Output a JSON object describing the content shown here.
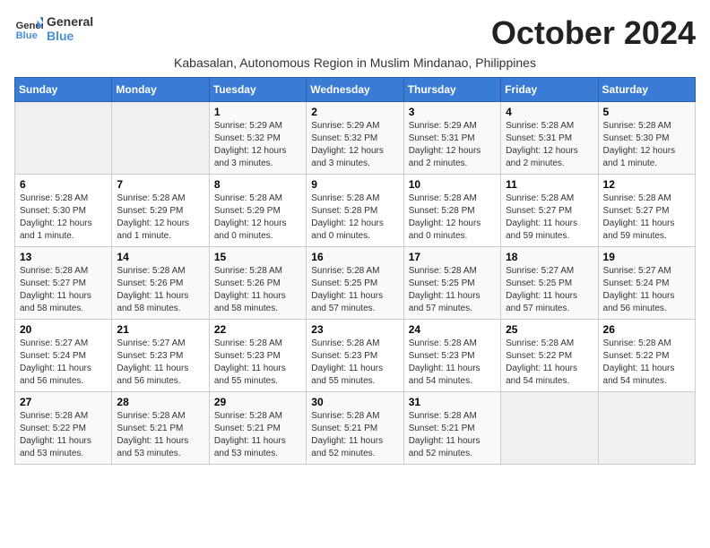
{
  "logo": {
    "line1": "General",
    "line2": "Blue"
  },
  "title": "October 2024",
  "subtitle": "Kabasalan, Autonomous Region in Muslim Mindanao, Philippines",
  "days_of_week": [
    "Sunday",
    "Monday",
    "Tuesday",
    "Wednesday",
    "Thursday",
    "Friday",
    "Saturday"
  ],
  "weeks": [
    [
      {
        "day": "",
        "info": ""
      },
      {
        "day": "",
        "info": ""
      },
      {
        "day": "1",
        "info": "Sunrise: 5:29 AM\nSunset: 5:32 PM\nDaylight: 12 hours and 3 minutes."
      },
      {
        "day": "2",
        "info": "Sunrise: 5:29 AM\nSunset: 5:32 PM\nDaylight: 12 hours and 3 minutes."
      },
      {
        "day": "3",
        "info": "Sunrise: 5:29 AM\nSunset: 5:31 PM\nDaylight: 12 hours and 2 minutes."
      },
      {
        "day": "4",
        "info": "Sunrise: 5:28 AM\nSunset: 5:31 PM\nDaylight: 12 hours and 2 minutes."
      },
      {
        "day": "5",
        "info": "Sunrise: 5:28 AM\nSunset: 5:30 PM\nDaylight: 12 hours and 1 minute."
      }
    ],
    [
      {
        "day": "6",
        "info": "Sunrise: 5:28 AM\nSunset: 5:30 PM\nDaylight: 12 hours and 1 minute."
      },
      {
        "day": "7",
        "info": "Sunrise: 5:28 AM\nSunset: 5:29 PM\nDaylight: 12 hours and 1 minute."
      },
      {
        "day": "8",
        "info": "Sunrise: 5:28 AM\nSunset: 5:29 PM\nDaylight: 12 hours and 0 minutes."
      },
      {
        "day": "9",
        "info": "Sunrise: 5:28 AM\nSunset: 5:28 PM\nDaylight: 12 hours and 0 minutes."
      },
      {
        "day": "10",
        "info": "Sunrise: 5:28 AM\nSunset: 5:28 PM\nDaylight: 12 hours and 0 minutes."
      },
      {
        "day": "11",
        "info": "Sunrise: 5:28 AM\nSunset: 5:27 PM\nDaylight: 11 hours and 59 minutes."
      },
      {
        "day": "12",
        "info": "Sunrise: 5:28 AM\nSunset: 5:27 PM\nDaylight: 11 hours and 59 minutes."
      }
    ],
    [
      {
        "day": "13",
        "info": "Sunrise: 5:28 AM\nSunset: 5:27 PM\nDaylight: 11 hours and 58 minutes."
      },
      {
        "day": "14",
        "info": "Sunrise: 5:28 AM\nSunset: 5:26 PM\nDaylight: 11 hours and 58 minutes."
      },
      {
        "day": "15",
        "info": "Sunrise: 5:28 AM\nSunset: 5:26 PM\nDaylight: 11 hours and 58 minutes."
      },
      {
        "day": "16",
        "info": "Sunrise: 5:28 AM\nSunset: 5:25 PM\nDaylight: 11 hours and 57 minutes."
      },
      {
        "day": "17",
        "info": "Sunrise: 5:28 AM\nSunset: 5:25 PM\nDaylight: 11 hours and 57 minutes."
      },
      {
        "day": "18",
        "info": "Sunrise: 5:27 AM\nSunset: 5:25 PM\nDaylight: 11 hours and 57 minutes."
      },
      {
        "day": "19",
        "info": "Sunrise: 5:27 AM\nSunset: 5:24 PM\nDaylight: 11 hours and 56 minutes."
      }
    ],
    [
      {
        "day": "20",
        "info": "Sunrise: 5:27 AM\nSunset: 5:24 PM\nDaylight: 11 hours and 56 minutes."
      },
      {
        "day": "21",
        "info": "Sunrise: 5:27 AM\nSunset: 5:23 PM\nDaylight: 11 hours and 56 minutes."
      },
      {
        "day": "22",
        "info": "Sunrise: 5:28 AM\nSunset: 5:23 PM\nDaylight: 11 hours and 55 minutes."
      },
      {
        "day": "23",
        "info": "Sunrise: 5:28 AM\nSunset: 5:23 PM\nDaylight: 11 hours and 55 minutes."
      },
      {
        "day": "24",
        "info": "Sunrise: 5:28 AM\nSunset: 5:23 PM\nDaylight: 11 hours and 54 minutes."
      },
      {
        "day": "25",
        "info": "Sunrise: 5:28 AM\nSunset: 5:22 PM\nDaylight: 11 hours and 54 minutes."
      },
      {
        "day": "26",
        "info": "Sunrise: 5:28 AM\nSunset: 5:22 PM\nDaylight: 11 hours and 54 minutes."
      }
    ],
    [
      {
        "day": "27",
        "info": "Sunrise: 5:28 AM\nSunset: 5:22 PM\nDaylight: 11 hours and 53 minutes."
      },
      {
        "day": "28",
        "info": "Sunrise: 5:28 AM\nSunset: 5:21 PM\nDaylight: 11 hours and 53 minutes."
      },
      {
        "day": "29",
        "info": "Sunrise: 5:28 AM\nSunset: 5:21 PM\nDaylight: 11 hours and 53 minutes."
      },
      {
        "day": "30",
        "info": "Sunrise: 5:28 AM\nSunset: 5:21 PM\nDaylight: 11 hours and 52 minutes."
      },
      {
        "day": "31",
        "info": "Sunrise: 5:28 AM\nSunset: 5:21 PM\nDaylight: 11 hours and 52 minutes."
      },
      {
        "day": "",
        "info": ""
      },
      {
        "day": "",
        "info": ""
      }
    ]
  ]
}
